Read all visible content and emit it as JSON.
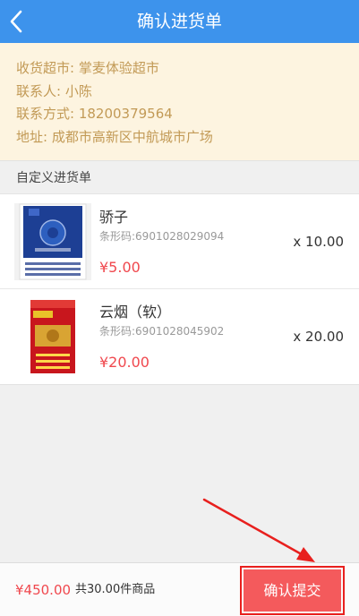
{
  "header": {
    "title": "确认进货单",
    "back_icon": "chevron-left-icon"
  },
  "shop": {
    "supermarket": "收货超市: 掌麦体验超市",
    "contact": "联系人: 小陈",
    "phone": "联系方式: 18200379564",
    "address": "地址: 成都市高新区中航城市广场"
  },
  "section": {
    "title": "自定义进货单"
  },
  "items": [
    {
      "name": "骄子",
      "barcode": "条形码:6901028029094",
      "price": "¥5.00",
      "quantity": "x 10.00"
    },
    {
      "name": "云烟（软）",
      "barcode": "条形码:6901028045902",
      "price": "¥20.00",
      "quantity": "x 20.00"
    }
  ],
  "footer": {
    "total": "¥450.00",
    "count": "共30.00件商品",
    "submit_label": "确认提交"
  },
  "colors": {
    "header": "#3d93ec",
    "accent": "#f0484e",
    "shop_bg": "#fdf4e0",
    "shop_text": "#c29a56",
    "annotation": "#e8201e"
  }
}
